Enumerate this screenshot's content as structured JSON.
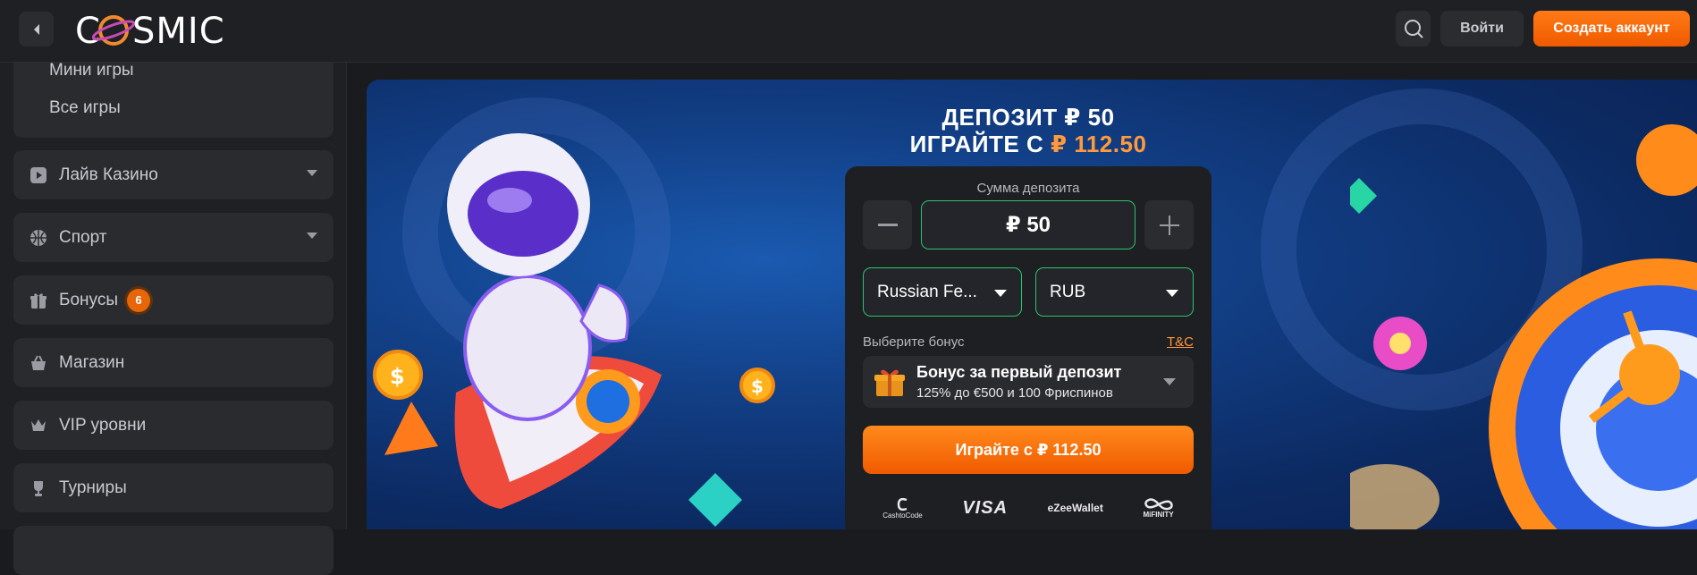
{
  "header": {
    "logo_text": "C SMIC",
    "login_label": "Войти",
    "signup_label": "Создать аккаунт"
  },
  "sidebar": {
    "sub_items": [
      {
        "label": "Мини игры"
      },
      {
        "label": "Все игры"
      }
    ],
    "items": [
      {
        "label": "Лайв Казино",
        "icon": "live-casino-icon",
        "has_chevron": true
      },
      {
        "label": "Спорт",
        "icon": "sport-ball-icon",
        "has_chevron": true
      },
      {
        "label": "Бонусы",
        "icon": "gift-icon",
        "badge": "6"
      },
      {
        "label": "Магазин",
        "icon": "shop-basket-icon"
      },
      {
        "label": "VIP уровни",
        "icon": "crown-icon"
      },
      {
        "label": "Турниры",
        "icon": "trophy-icon"
      }
    ]
  },
  "banner": {
    "headline_line1": "ДЕПОЗИТ ₽ 50",
    "headline_line2_prefix": "ИГРАЙТЕ С ",
    "headline_line2_amount": "₽ 112.50"
  },
  "deposit": {
    "amount_label": "Сумма депозита",
    "amount_value": "₽ 50",
    "country_value": "Russian Fe...",
    "currency_value": "RUB",
    "bonus_label": "Выберите бонус",
    "tc_label": "T&C",
    "bonus_title": "Бонус за первый депозит",
    "bonus_sub": "125% до €500 и 100 Фриспинов",
    "play_label": "Играйте с ₽ 112.50",
    "payments": [
      "CashtoCode",
      "VISA",
      "eZeeWallet",
      "MiFINITY"
    ]
  },
  "colors": {
    "accent": "#f05a00",
    "success_border": "#2ec36a",
    "banner_bg": "#123f86"
  }
}
